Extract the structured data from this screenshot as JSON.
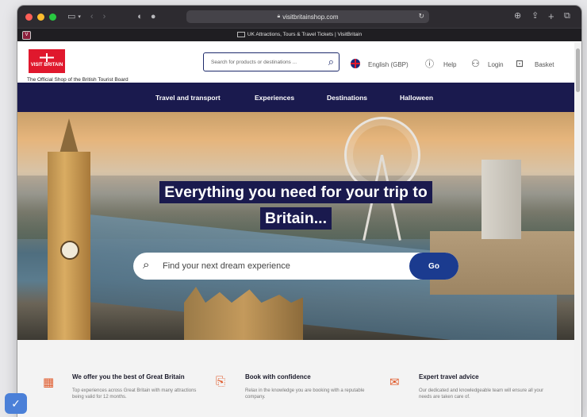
{
  "browser": {
    "url": "visitbritainshop.com",
    "tab_title": "UK Attractions, Tours & Travel Tickets | VisitBritain",
    "tab_left_favicon": "V"
  },
  "header": {
    "logo_text": "VISIT BRITAIN",
    "tagline": "The Official Shop of the British Tourist Board",
    "search_placeholder": "Search for products or destinations ...",
    "language": "English (GBP)",
    "help": "Help",
    "login": "Login",
    "basket": "Basket"
  },
  "nav": {
    "items": [
      "Travel and transport",
      "Experiences",
      "Destinations",
      "Halloween"
    ]
  },
  "hero": {
    "title_line1": "Everything you need for your trip to",
    "title_line2": "Britain...",
    "search_placeholder": "Find your next dream experience",
    "go_label": "Go"
  },
  "features": [
    {
      "icon": "calendar-icon",
      "title": "We offer you the best of Great Britain",
      "desc": "Top experiences across Great Britain with many attractions being valid for 12 months."
    },
    {
      "icon": "booking-icon",
      "title": "Book with confidence",
      "desc": "Relax in the knowledge you are booking with a reputable company."
    },
    {
      "icon": "advice-icon",
      "title": "Expert travel advice",
      "desc": "Our dedicated and knowledgeable team will ensure all your needs are taken care of."
    }
  ],
  "colors": {
    "nav_bg": "#1a1a4e",
    "brand_red": "#e0182d",
    "go_button": "#1b3b8f",
    "feature_icon": "#e05a2b"
  }
}
